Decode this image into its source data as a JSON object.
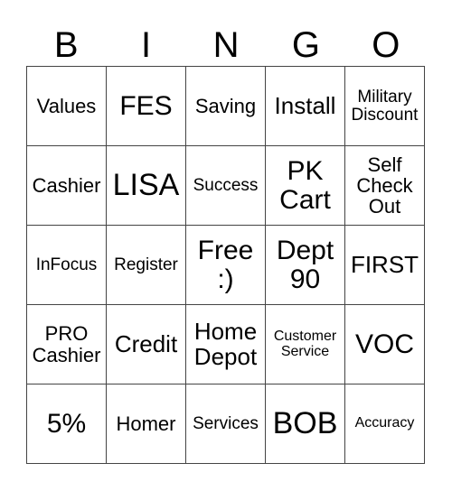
{
  "header": {
    "letters": [
      "B",
      "I",
      "N",
      "G",
      "O"
    ]
  },
  "rows": [
    [
      "Values",
      "FES",
      "Saving",
      "Install",
      "Military\nDiscount"
    ],
    [
      "Cashier",
      "LISA",
      "Success",
      "PK\nCart",
      "Self\nCheck\nOut"
    ],
    [
      "InFocus",
      "Register",
      "Free\n:)",
      "Dept\n90",
      "FIRST"
    ],
    [
      "PRO\nCashier",
      "Credit",
      "Home\nDepot",
      "Customer\nService",
      "VOC"
    ],
    [
      "5%",
      "Homer",
      "Services",
      "BOB",
      "Accuracy"
    ]
  ]
}
